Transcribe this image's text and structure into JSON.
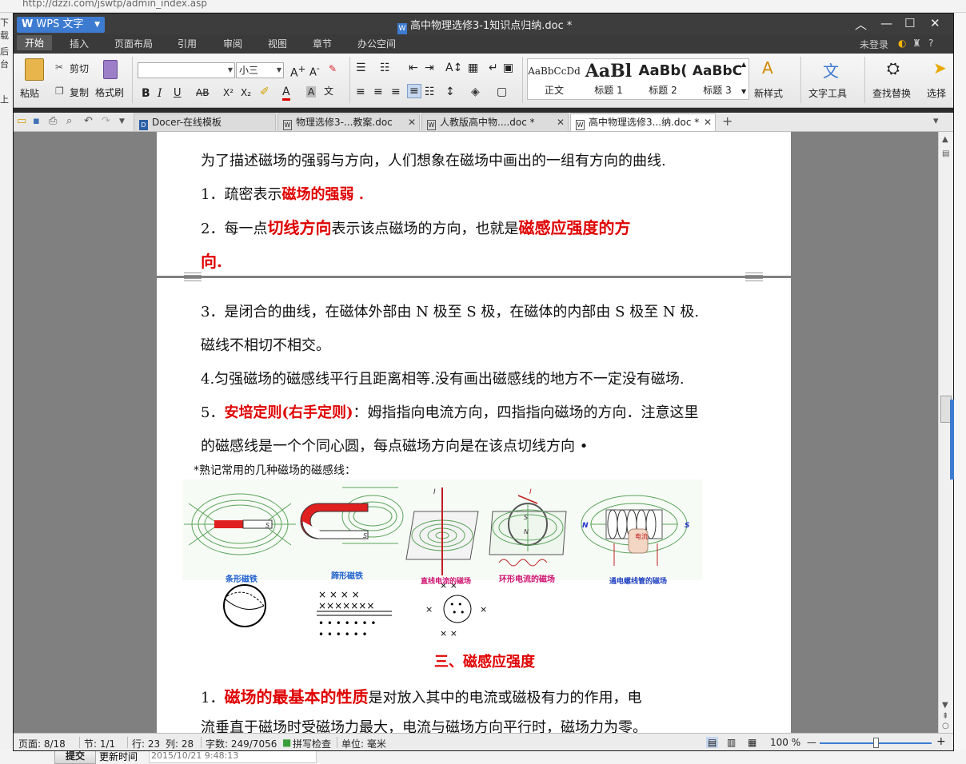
{
  "background": {
    "url": "http://dzzi.com/jswtp/admin_index.asp",
    "left_labels": [
      "下载",
      "后台",
      "上"
    ],
    "submit_label": "提交",
    "update_label": "更新时间",
    "update_time": "2015/10/21 9:48:13"
  },
  "titlebar": {
    "app_name": "WPS 文字",
    "doc_title": "高中物理选修3-1知识点归纳.doc *"
  },
  "menu": {
    "items": [
      "开始",
      "插入",
      "页面布局",
      "引用",
      "审阅",
      "视图",
      "章节",
      "办公空间"
    ],
    "right_status": "未登录",
    "help": "?"
  },
  "ribbon": {
    "paste": "粘贴",
    "cut": "剪切",
    "copy": "复制",
    "format_painter": "格式刷",
    "font_name": "",
    "font_size": "小三",
    "styles": [
      {
        "sample": "AaBbCcDd",
        "caption": "正文"
      },
      {
        "sample": "AaBl",
        "caption": "标题 1"
      },
      {
        "sample": "AaBb(",
        "caption": "标题 2"
      },
      {
        "sample": "AaBbC",
        "caption": "标题 3"
      }
    ],
    "new_style": "新样式",
    "text_tools": "文字工具",
    "find_replace": "查找替换",
    "select": "选择"
  },
  "tabs": [
    {
      "label": "Docer-在线模板",
      "active": false
    },
    {
      "label": "物理选修3-...教案.doc",
      "active": false
    },
    {
      "label": "人教版高中物....doc *",
      "active": false
    },
    {
      "label": "高中物理选修3...纳.doc *",
      "active": true
    }
  ],
  "document": {
    "p1": "为了描述磁场的强弱与方向，人们想象在磁场中画出的一组有方向的曲线.",
    "p2_prefix": "1．疏密表示",
    "p2_red": "磁场的强弱 .",
    "p3_prefix": "2．每一点",
    "p3_red1": "切线方向",
    "p3_mid": "表示该点磁场的方向，也就是",
    "p3_red2": "磁感应强度的方",
    "p3_red3": "向.",
    "p4": "3．是闭合的曲线，在磁体外部由 N 极至 S 极，在磁体的内部由 S 极至 N 极.",
    "p5": "磁线不相切不相交。",
    "p6": "4.匀强磁场的磁感线平行且距离相等.没有画出磁感线的地方不一定没有磁场.",
    "p7_prefix": "5．",
    "p7_red": "安培定则(右手定则)",
    "p7_rest": "：姆指指向电流方向，四指指向磁场的方向．注意这里",
    "p8": "的磁感线是一个个同心圆，每点磁场方向是在该点切线方向 •",
    "note": "*熟记常用的几种磁场的磁感线：",
    "fig_captions": [
      "条形磁铁",
      "蹄形磁铁",
      "直线电流的磁场",
      "环形电流的磁场",
      "通电螺线管的磁场"
    ],
    "fig_labels": {
      "n": "N",
      "s": "S",
      "i": "I",
      "current": "电流"
    },
    "heading3": "三、磁感应强度",
    "p9_prefix": "1．",
    "p9_red": "磁场的最基本的性质",
    "p9_rest": "是对放入其中的电流或磁极有力的作用，电",
    "p10": "流垂直于磁场时受磁场力最大，电流与磁场方向平行时，磁场力为零。"
  },
  "status": {
    "page": "页面: 8/18",
    "section": "节: 1/1",
    "row": "行: 23",
    "col": "列: 28",
    "words": "字数: 249/7056",
    "spell": "拼写检查",
    "unit": "单位: 毫米",
    "zoom": "100 %",
    "zoom_level": 0.5
  },
  "colors": {
    "accent": "#3d7bd1",
    "red_text": "#e00000"
  }
}
